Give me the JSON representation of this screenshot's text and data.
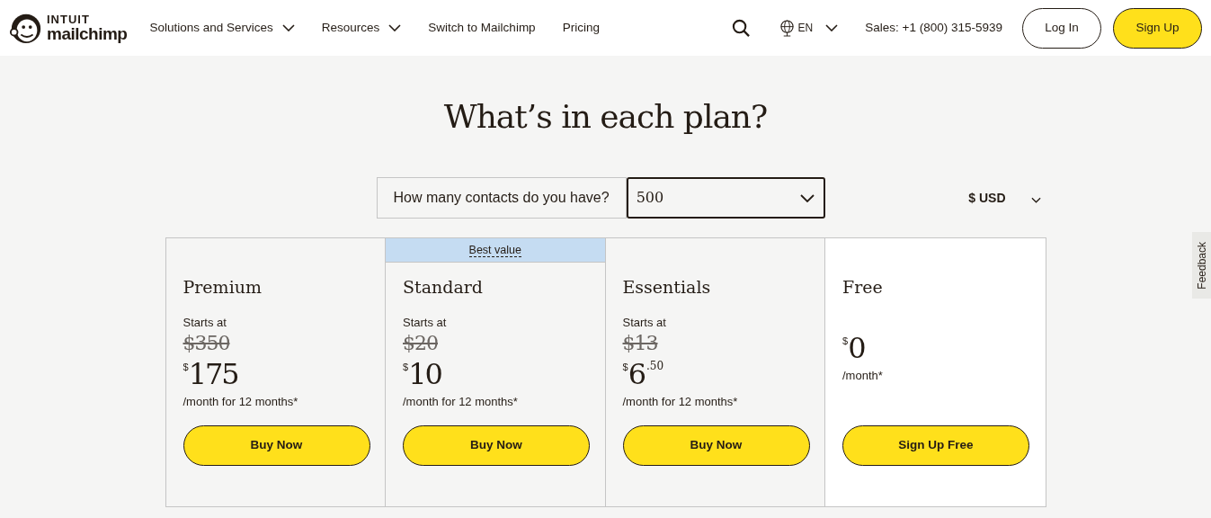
{
  "header": {
    "logo": {
      "top": "INTUIT",
      "bottom": "mailchimp"
    },
    "nav": [
      {
        "label": "Solutions and Services",
        "dropdown": true
      },
      {
        "label": "Resources",
        "dropdown": true
      },
      {
        "label": "Switch to Mailchimp",
        "dropdown": false
      },
      {
        "label": "Pricing",
        "dropdown": false
      }
    ],
    "language": "EN",
    "sales": "Sales: +1 (800) 315-5939",
    "login": "Log In",
    "signup": "Sign Up"
  },
  "title": "What’s in each plan?",
  "contacts": {
    "label": "How many contacts do you have?",
    "value": "500"
  },
  "currency": "$ USD",
  "plans": [
    {
      "kind": "paid",
      "name": "Premium",
      "starts_at": "Starts at",
      "old_price": "$350",
      "symbol": "$",
      "price": "175",
      "period": "/month for 12 months*",
      "button": "Buy Now"
    },
    {
      "kind": "paid",
      "name": "Standard",
      "badge": "Best value",
      "starts_at": "Starts at",
      "old_price": "$20",
      "symbol": "$",
      "price": "10",
      "period": "/month for 12 months*",
      "button": "Buy Now"
    },
    {
      "kind": "paid",
      "name": "Essentials",
      "starts_at": "Starts at",
      "old_price": "$13",
      "symbol": "$",
      "price": "6",
      "cents": ".50",
      "period": "/month for 12 months*",
      "button": "Buy Now"
    },
    {
      "kind": "free",
      "name": "Free",
      "symbol": "$",
      "price": "0",
      "period": "/month*",
      "button": "Sign Up Free"
    }
  ],
  "feedback": "Feedback"
}
